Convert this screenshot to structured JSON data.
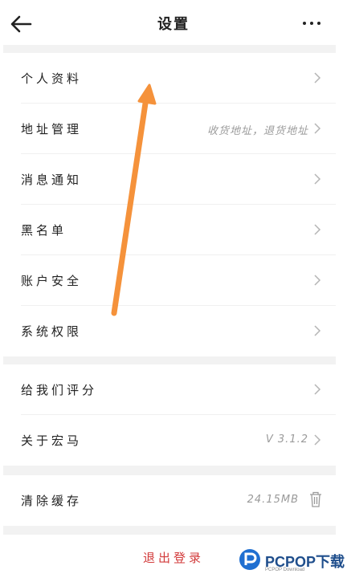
{
  "header": {
    "title": "设置",
    "back_icon": "arrow-left-icon",
    "more_icon": "more-dots-icon"
  },
  "settings_group_1": [
    {
      "label": "个人资料",
      "value": ""
    },
    {
      "label": "地址管理",
      "value": "收货地址，退货地址"
    },
    {
      "label": "消息通知",
      "value": ""
    },
    {
      "label": "黑名单",
      "value": ""
    },
    {
      "label": "账户安全",
      "value": ""
    },
    {
      "label": "系统权限",
      "value": ""
    }
  ],
  "settings_group_2": [
    {
      "label": "给我们评分",
      "value": ""
    },
    {
      "label": "关于宏马",
      "value": "V 3.1.2"
    }
  ],
  "settings_group_3": [
    {
      "label": "清除缓存",
      "value": "24.15MB"
    }
  ],
  "logout": {
    "label": "退出登录"
  },
  "watermark": {
    "text": "PCPOP下载",
    "sub": "PCPOP Download"
  },
  "colors": {
    "accent_arrow": "#f5923b",
    "logout_red": "#d23a3a",
    "section_gap": "#f2f2f2"
  }
}
